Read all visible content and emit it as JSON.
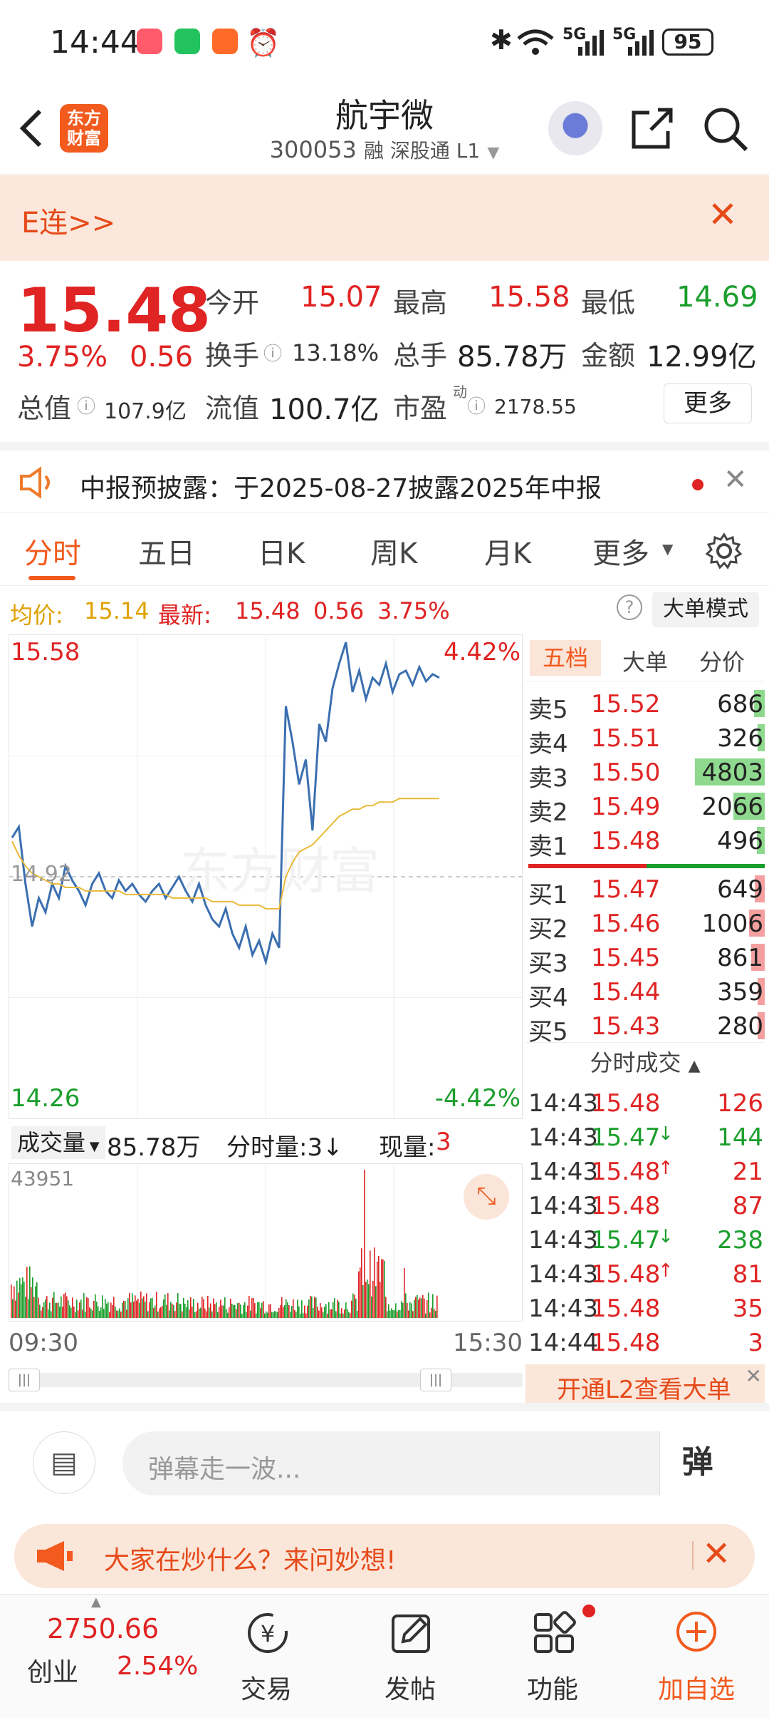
{
  "status_bar": {
    "time": "14:44",
    "battery": "95",
    "signal1": "5G",
    "signal2": "5G"
  },
  "header": {
    "logo_line1": "东方",
    "logo_line2": "财富",
    "title": "航宇微",
    "code": "300053",
    "tags": "融  深股通  L1"
  },
  "banner": {
    "text": "E连>>"
  },
  "quote": {
    "price": "15.48",
    "change_pct": "3.75%",
    "change": "0.56",
    "open_label": "今开",
    "open": "15.07",
    "high_label": "最高",
    "high": "15.58",
    "low_label": "最低",
    "low": "14.69",
    "turnover_label": "换手",
    "turnover": "13.18%",
    "volume_label": "总手",
    "volume": "85.78万",
    "amount_label": "金额",
    "amount": "12.99亿",
    "mktcap_label": "总值",
    "mktcap": "107.9亿",
    "float_label": "流值",
    "float": "100.7亿",
    "pe_label": "市盈",
    "pe_sup": "动",
    "pe": "2178.55",
    "more": "更多"
  },
  "notice": {
    "text": "中报预披露：于2025-08-27披露2025年中报"
  },
  "tabs": [
    {
      "label": "分时"
    },
    {
      "label": "五日"
    },
    {
      "label": "日K"
    },
    {
      "label": "周K"
    },
    {
      "label": "月K"
    },
    {
      "label": "更多"
    }
  ],
  "info_line": {
    "avg_label": "均价:",
    "avg": "15.14",
    "latest_label": "最新:",
    "latest": "15.48",
    "change": "0.56",
    "pct": "3.75%",
    "mode": "大单模式"
  },
  "chart_data": {
    "type": "line",
    "y_top": "15.58",
    "y_bottom": "14.26",
    "y_mid": "14.92",
    "pct_top": "4.42%",
    "pct_bottom": "-4.42%",
    "x_start": "09:30",
    "x_end": "15:30",
    "ylim": [
      14.26,
      15.58
    ],
    "series": [
      {
        "name": "price",
        "values": [
          15.03,
          15.06,
          14.9,
          14.78,
          14.86,
          14.82,
          14.9,
          14.86,
          14.95,
          14.91,
          14.88,
          14.84,
          14.9,
          14.93,
          14.88,
          14.86,
          14.91,
          14.88,
          14.9,
          14.87,
          14.85,
          14.88,
          14.9,
          14.86,
          14.89,
          14.92,
          14.88,
          14.85,
          14.9,
          14.84,
          14.8,
          14.78,
          14.83,
          14.76,
          14.72,
          14.78,
          14.7,
          14.74,
          14.68,
          14.76,
          14.72,
          15.4,
          15.3,
          15.18,
          15.25,
          15.05,
          15.35,
          15.3,
          15.45,
          15.52,
          15.58,
          15.44,
          15.5,
          15.42,
          15.48,
          15.46,
          15.52,
          15.44,
          15.49,
          15.5,
          15.46,
          15.51,
          15.47,
          15.49,
          15.48
        ]
      },
      {
        "name": "avg",
        "values": [
          15.02,
          14.98,
          14.95,
          14.93,
          14.92,
          14.91,
          14.9,
          14.9,
          14.89,
          14.89,
          14.89,
          14.88,
          14.88,
          14.88,
          14.88,
          14.88,
          14.88,
          14.87,
          14.87,
          14.87,
          14.87,
          14.87,
          14.87,
          14.87,
          14.86,
          14.86,
          14.86,
          14.86,
          14.86,
          14.86,
          14.85,
          14.85,
          14.85,
          14.85,
          14.84,
          14.84,
          14.84,
          14.84,
          14.83,
          14.83,
          14.83,
          14.92,
          14.96,
          14.99,
          15.0,
          15.01,
          15.03,
          15.05,
          15.07,
          15.09,
          15.1,
          15.11,
          15.11,
          15.12,
          15.12,
          15.13,
          15.13,
          15.13,
          15.14,
          15.14,
          15.14,
          15.14,
          15.14,
          15.14,
          15.14
        ]
      }
    ]
  },
  "volume": {
    "label": "成交量",
    "total": "85.78万",
    "split_label": "分时量:3↓",
    "now_label": "现量:",
    "now": "3",
    "max": "43951"
  },
  "orderbook": {
    "tabs": [
      "五档",
      "大单",
      "分价"
    ],
    "asks": [
      {
        "label": "卖5",
        "price": "15.52",
        "vol": "686",
        "bar": 0.15
      },
      {
        "label": "卖4",
        "price": "15.51",
        "vol": "326",
        "bar": 0.07
      },
      {
        "label": "卖3",
        "price": "15.50",
        "vol": "4803",
        "bar": 1.0
      },
      {
        "label": "卖2",
        "price": "15.49",
        "vol": "2066",
        "bar": 0.45
      },
      {
        "label": "卖1",
        "price": "15.48",
        "vol": "496",
        "bar": 0.11
      }
    ],
    "bids": [
      {
        "label": "买1",
        "price": "15.47",
        "vol": "649",
        "bar": 0.14
      },
      {
        "label": "买2",
        "price": "15.46",
        "vol": "1006",
        "bar": 0.22
      },
      {
        "label": "买3",
        "price": "15.45",
        "vol": "861",
        "bar": 0.19
      },
      {
        "label": "买4",
        "price": "15.44",
        "vol": "359",
        "bar": 0.08
      },
      {
        "label": "买5",
        "price": "15.43",
        "vol": "280",
        "bar": 0.06
      }
    ],
    "trades_title": "分时成交",
    "trades": [
      {
        "t": "14:43",
        "p": "15.48",
        "arrow": "",
        "v": "126",
        "c": "red"
      },
      {
        "t": "14:43",
        "p": "15.47",
        "arrow": "↓",
        "v": "144",
        "c": "green"
      },
      {
        "t": "14:43",
        "p": "15.48",
        "arrow": "↑",
        "v": "21",
        "c": "red"
      },
      {
        "t": "14:43",
        "p": "15.48",
        "arrow": "",
        "v": "87",
        "c": "red"
      },
      {
        "t": "14:43",
        "p": "15.47",
        "arrow": "↓",
        "v": "238",
        "c": "green"
      },
      {
        "t": "14:43",
        "p": "15.48",
        "arrow": "↑",
        "v": "81",
        "c": "red"
      },
      {
        "t": "14:43",
        "p": "15.48",
        "arrow": "",
        "v": "35",
        "c": "red"
      },
      {
        "t": "14:44",
        "p": "15.48",
        "arrow": "",
        "v": "3",
        "c": "red"
      }
    ],
    "l2": "开通L2查看大单"
  },
  "chat": {
    "placeholder": "弹幕走一波...",
    "danmu_btn": "弹"
  },
  "ask": {
    "text": "大家在炒什么？来问妙想!"
  },
  "bottom_nav": {
    "index_value": "2750.66",
    "index_name": "创业",
    "index_pct": "2.54%",
    "trade": "交易",
    "post": "发帖",
    "func": "功能",
    "add": "加自选"
  },
  "colors": {
    "up": "#e02323",
    "down": "#1a9e2c",
    "accent": "#ff5a1f",
    "avg": "#e9b938",
    "price_line": "#3b6fb0"
  }
}
